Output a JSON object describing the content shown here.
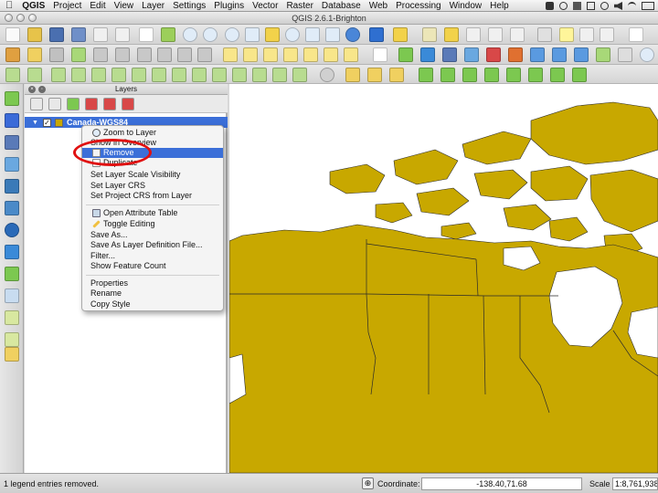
{
  "menubar": {
    "app": "QGIS",
    "items": [
      "Project",
      "Edit",
      "View",
      "Layer",
      "Settings",
      "Plugins",
      "Vector",
      "Raster",
      "Database",
      "Web",
      "Processing",
      "Window",
      "Help"
    ]
  },
  "window": {
    "title": "QGIS 2.6.1-Brighton"
  },
  "layers_panel": {
    "title": "Layers",
    "layer": {
      "name": "Canada-WGS84",
      "checked": true,
      "fill_color": "#c8a800"
    }
  },
  "context_menu": {
    "items": [
      {
        "label": "Zoom to Layer",
        "icon": "zoom-layer-icon"
      },
      {
        "label": "Show in Overview",
        "icon": ""
      },
      {
        "label": "Remove",
        "icon": "remove-layer-icon",
        "highlighted": true
      },
      {
        "label": "Duplicate",
        "icon": "duplicate-layer-icon"
      },
      {
        "label": "Set Layer Scale Visibility",
        "icon": ""
      },
      {
        "label": "Set Layer CRS",
        "icon": ""
      },
      {
        "label": "Set Project CRS from Layer",
        "icon": ""
      },
      {
        "label": "Open Attribute Table",
        "icon": "attribute-table-icon"
      },
      {
        "label": "Toggle Editing",
        "icon": "pencil-icon"
      },
      {
        "label": "Save As...",
        "icon": ""
      },
      {
        "label": "Save As Layer Definition File...",
        "icon": ""
      },
      {
        "label": "Filter...",
        "icon": ""
      },
      {
        "label": "Show Feature Count",
        "icon": ""
      },
      {
        "label": "Properties",
        "icon": ""
      },
      {
        "label": "Rename",
        "icon": ""
      },
      {
        "label": "Copy Style",
        "icon": ""
      }
    ]
  },
  "status_bar": {
    "message": "1 legend entries removed.",
    "coordinate_label": "Coordinate:",
    "coordinate_value": "-138.40,71.68",
    "scale_label": "Scale",
    "scale_value": "1:8,761,938"
  },
  "map": {
    "land_color": "#c8a800",
    "water_color": "#ffffff",
    "border_color": "#2a2a2a"
  },
  "annotation": {
    "color": "#e01010"
  }
}
